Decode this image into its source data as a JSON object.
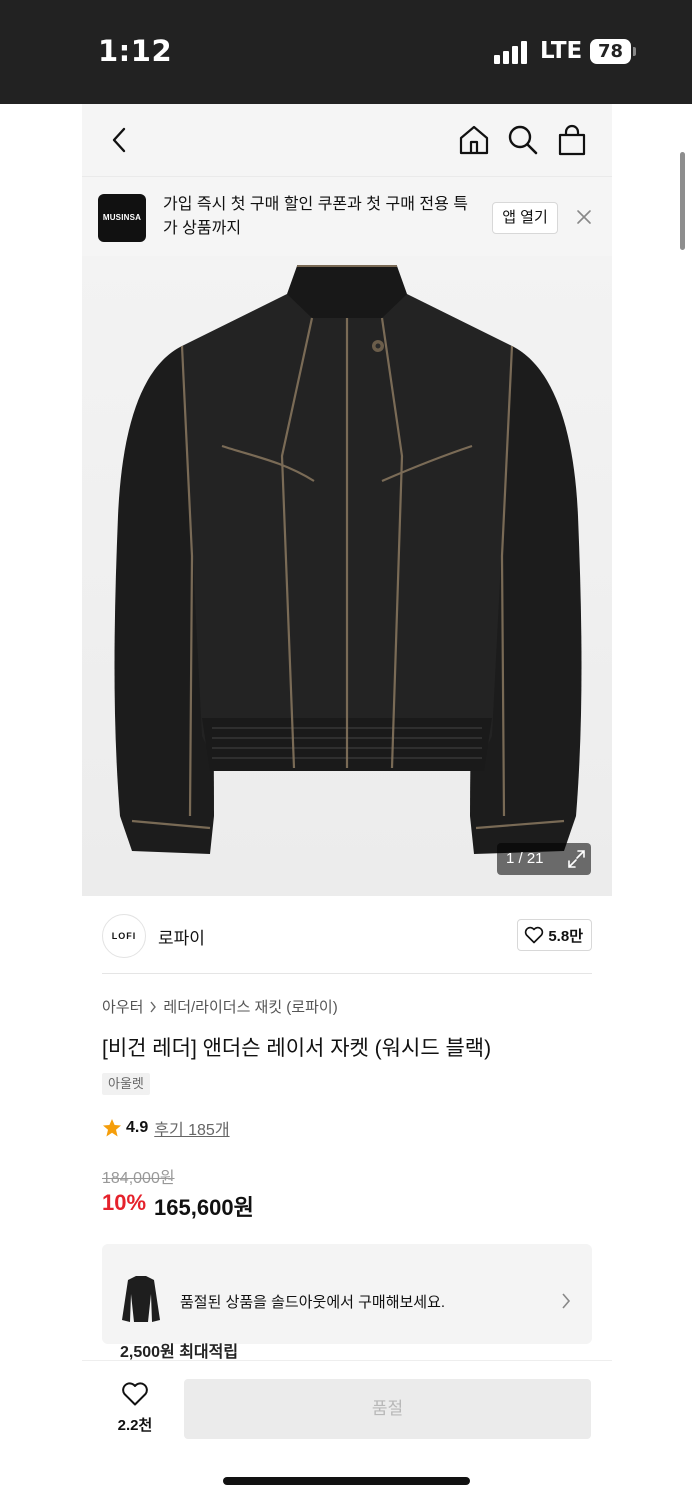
{
  "status_bar": {
    "time": "1:12",
    "network": "LTE",
    "battery": "78"
  },
  "nav": {
    "icons": [
      "back-icon",
      "home-icon",
      "search-icon",
      "bag-icon"
    ]
  },
  "app_banner": {
    "logo_text": "MUSINSA",
    "message": "가입 즉시 첫 구매 할인 쿠폰과 첫 구매 전용 특가 상품까지",
    "open_button": "앱 열기"
  },
  "gallery": {
    "counter": "1 / 21"
  },
  "brand": {
    "logo_text": "LOFI",
    "name": "로파이",
    "like_count": "5.8만"
  },
  "product": {
    "breadcrumb": [
      "아우터",
      "레더/라이더스 재킷 (로파이)"
    ],
    "title": "[비건 레더] 앤더슨 레이서 자켓 (워시드 블랙)",
    "tag": "아울렛",
    "rating": "4.9",
    "reviews": "후기 185개",
    "original_price": "184,000원",
    "discount": "10%",
    "price": "165,600원"
  },
  "soldout_card": {
    "message": "품절된 상품을 솔드아웃에서 구매해보세요.",
    "below_text": "2,500원 최대적립"
  },
  "bottom_bar": {
    "wish_count": "2.2천",
    "buy_label": "품절"
  },
  "colors": {
    "accent_red": "#e5222c",
    "status_bar": "#222222"
  }
}
